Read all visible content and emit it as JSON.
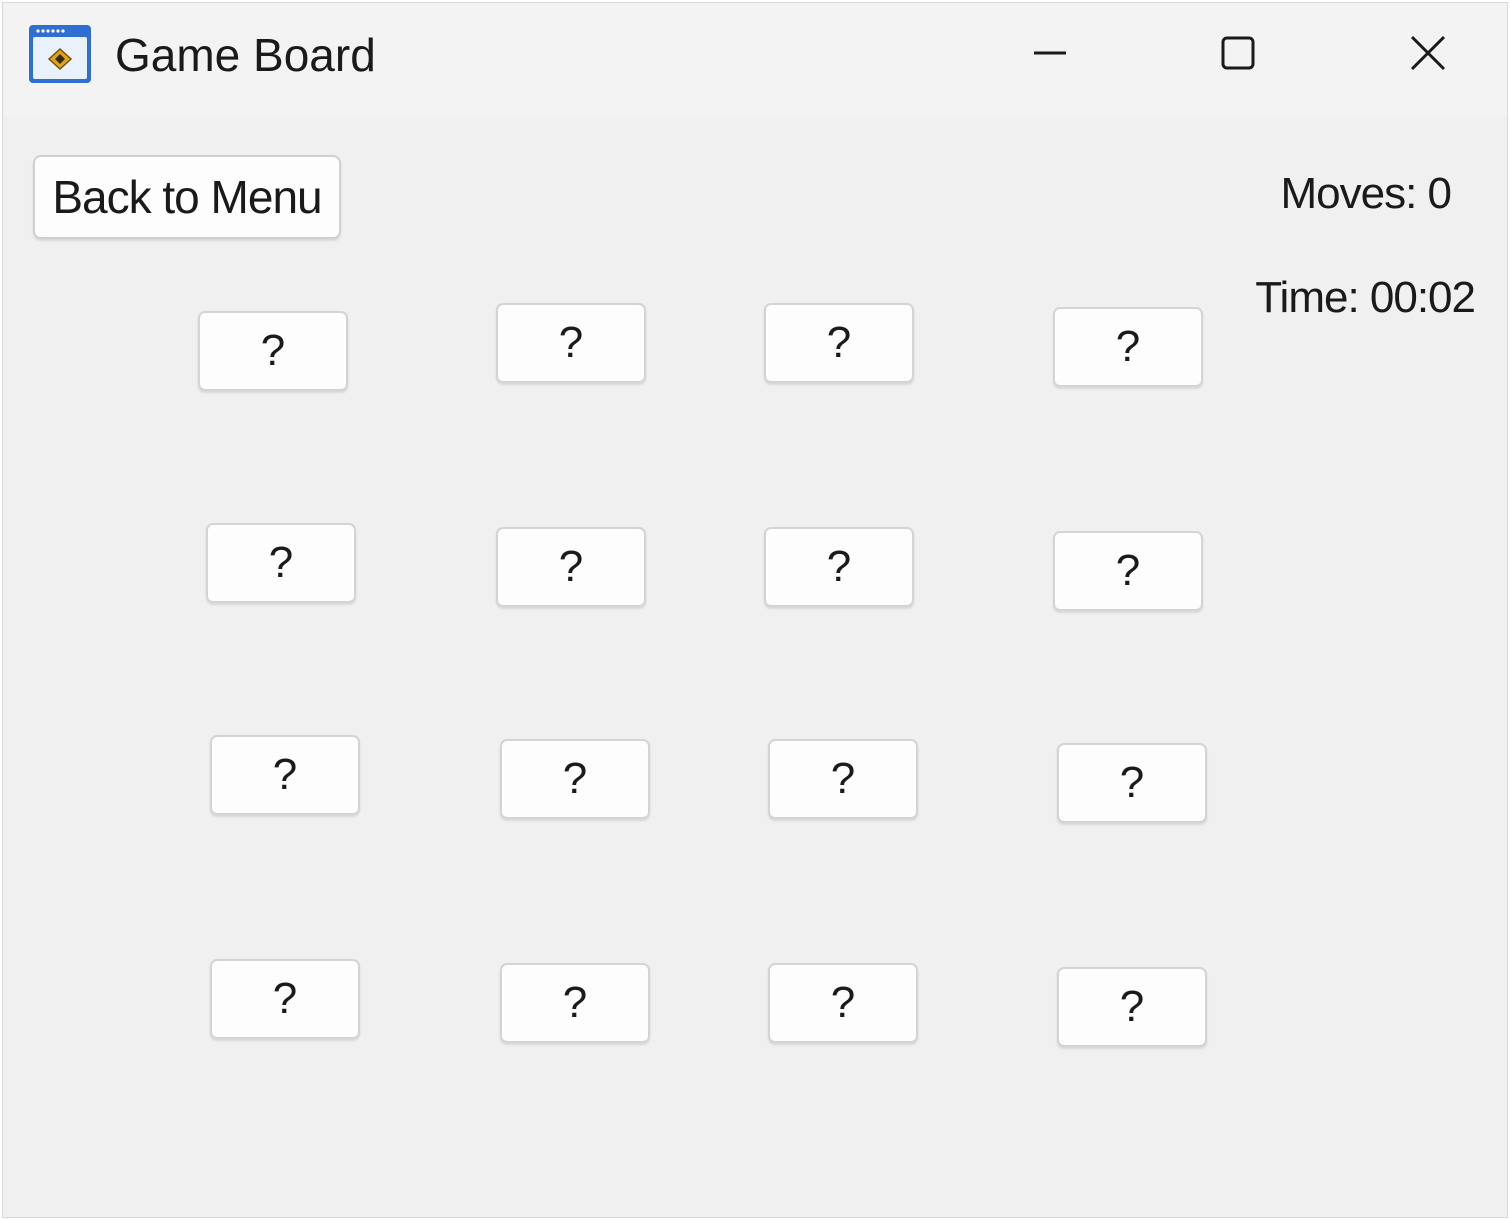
{
  "window": {
    "title": "Game Board",
    "icon": "app-window-icon"
  },
  "title_bar_buttons": {
    "minimize": "minimize-icon",
    "maximize": "maximize-icon",
    "close": "close-icon"
  },
  "toolbar": {
    "back_label": "Back to Menu"
  },
  "status": {
    "moves": "Moves: 0",
    "time": "Time: 00:02"
  },
  "board": {
    "rows": 4,
    "columns": 4,
    "cards": [
      "?",
      "?",
      "?",
      "?",
      "?",
      "?",
      "?",
      "?",
      "?",
      "?",
      "?",
      "?",
      "?",
      "?",
      "?",
      "?"
    ]
  },
  "colors": {
    "window_background": "#f0f0f0",
    "title_bar": "#f3f3f3",
    "button_face": "#fdfdfd",
    "button_border": "#d0d0d0",
    "text": "#1a1a1a",
    "icon_blue": "#2f6fd1",
    "icon_gold": "#e0a31c"
  }
}
